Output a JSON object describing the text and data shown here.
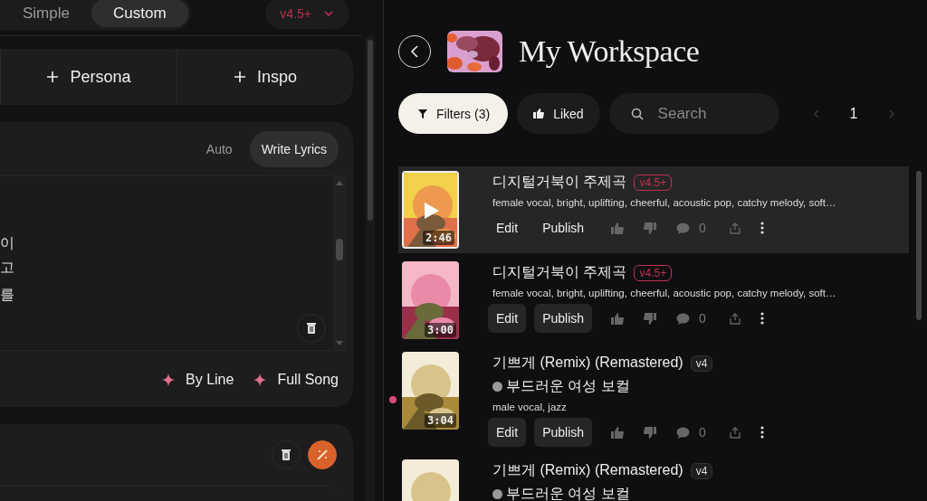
{
  "mode_toggle": [
    {
      "label": "Simple",
      "selected": false
    },
    {
      "label": "Custom",
      "selected": true
    }
  ],
  "model_selector": {
    "label": "v4.5+"
  },
  "add_buttons": [
    {
      "label": "Persona"
    },
    {
      "label": "Inspo"
    }
  ],
  "lyrics": {
    "modes": [
      {
        "label": "Auto",
        "selected": false
      },
      {
        "label": "Write Lyrics",
        "selected": true
      }
    ],
    "lines": [
      "이",
      "고",
      "를"
    ],
    "actions": [
      {
        "label": "By Line"
      },
      {
        "label": "Full Song"
      }
    ]
  },
  "workspace": {
    "title": "My Workspace"
  },
  "toolbar": {
    "filters": {
      "label": "Filters (3)"
    },
    "liked": {
      "label": "Liked"
    },
    "search": {
      "placeholder": "Search"
    },
    "page": "1"
  },
  "songs": [
    {
      "title": "디지털거북이 주제곡",
      "version": {
        "label": "v4.5+",
        "kind": "accent"
      },
      "tags": "female vocal, bright, uplifting, cheerful, acoustic pop, catchy melody, soft…",
      "duration": "2:46",
      "selected": true,
      "unread": false,
      "comments": "0",
      "actions": [
        "Edit",
        "Publish"
      ]
    },
    {
      "title": "디지털거북이 주제곡",
      "version": {
        "label": "v4.5+",
        "kind": "accent"
      },
      "tags": "female vocal, bright, uplifting, cheerful, acoustic pop, catchy melody, soft…",
      "duration": "3:00",
      "selected": false,
      "unread": false,
      "comments": "0",
      "actions": [
        "Edit",
        "Publish"
      ]
    },
    {
      "title": "기쁘게 (Remix) (Remastered)",
      "version": {
        "label": "v4",
        "kind": "plain"
      },
      "persona": "부드러운 여성 보컬",
      "tags": "male vocal, jazz",
      "duration": "3:04",
      "selected": false,
      "unread": true,
      "comments": "0",
      "actions": [
        "Edit",
        "Publish"
      ]
    },
    {
      "title": "기쁘게 (Remix) (Remastered)",
      "version": {
        "label": "v4",
        "kind": "plain"
      },
      "persona": "부드러운 여성 보컬",
      "selected": false,
      "unread": false
    }
  ]
}
